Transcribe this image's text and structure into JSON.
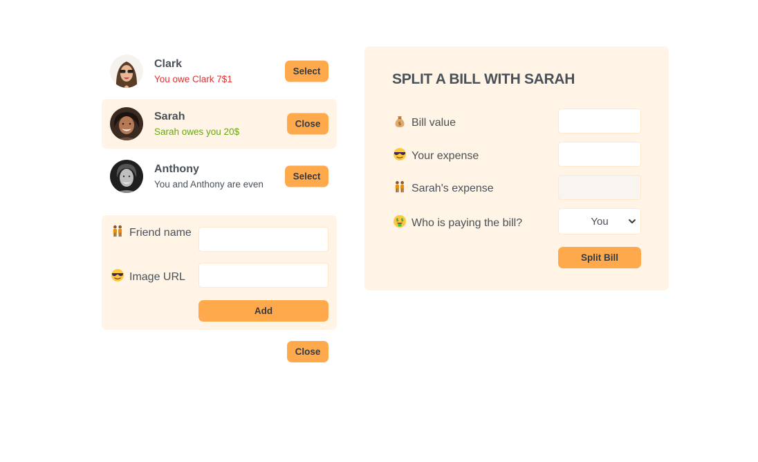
{
  "friends": [
    {
      "name": "Clark",
      "status": "You owe Clark 7$1",
      "button": "Select"
    },
    {
      "name": "Sarah",
      "status": "Sarah owes you 20$",
      "button": "Close"
    },
    {
      "name": "Anthony",
      "status": "You and Anthony are even",
      "button": "Select"
    }
  ],
  "add_form": {
    "friend_name_label": "Friend name",
    "image_url_label": "Image URL",
    "add_button": "Add",
    "friend_name_value": "",
    "image_url_value": ""
  },
  "close_button": "Close",
  "split_form": {
    "title": "SPLIT A BILL WITH SARAH",
    "bill_value_label": "Bill value",
    "your_expense_label": "Your expense",
    "friend_expense_label": "Sarah's expense",
    "payer_label": "Who is paying the bill?",
    "payer_selected": "You",
    "split_button": "Split Bill"
  },
  "icons": {
    "bill_value": "money-bag-icon",
    "your_expense": "sunglasses-face-icon",
    "friend_expense": "people-icon",
    "payer": "money-mouth-face-icon",
    "friend_name": "people-icon",
    "image_url": "sunglasses-face-icon"
  },
  "colors": {
    "accent": "#ffa94d",
    "panel_bg": "#fff4e6",
    "owe_red": "#e03131",
    "owed_green": "#66a80f",
    "text": "#495057"
  }
}
